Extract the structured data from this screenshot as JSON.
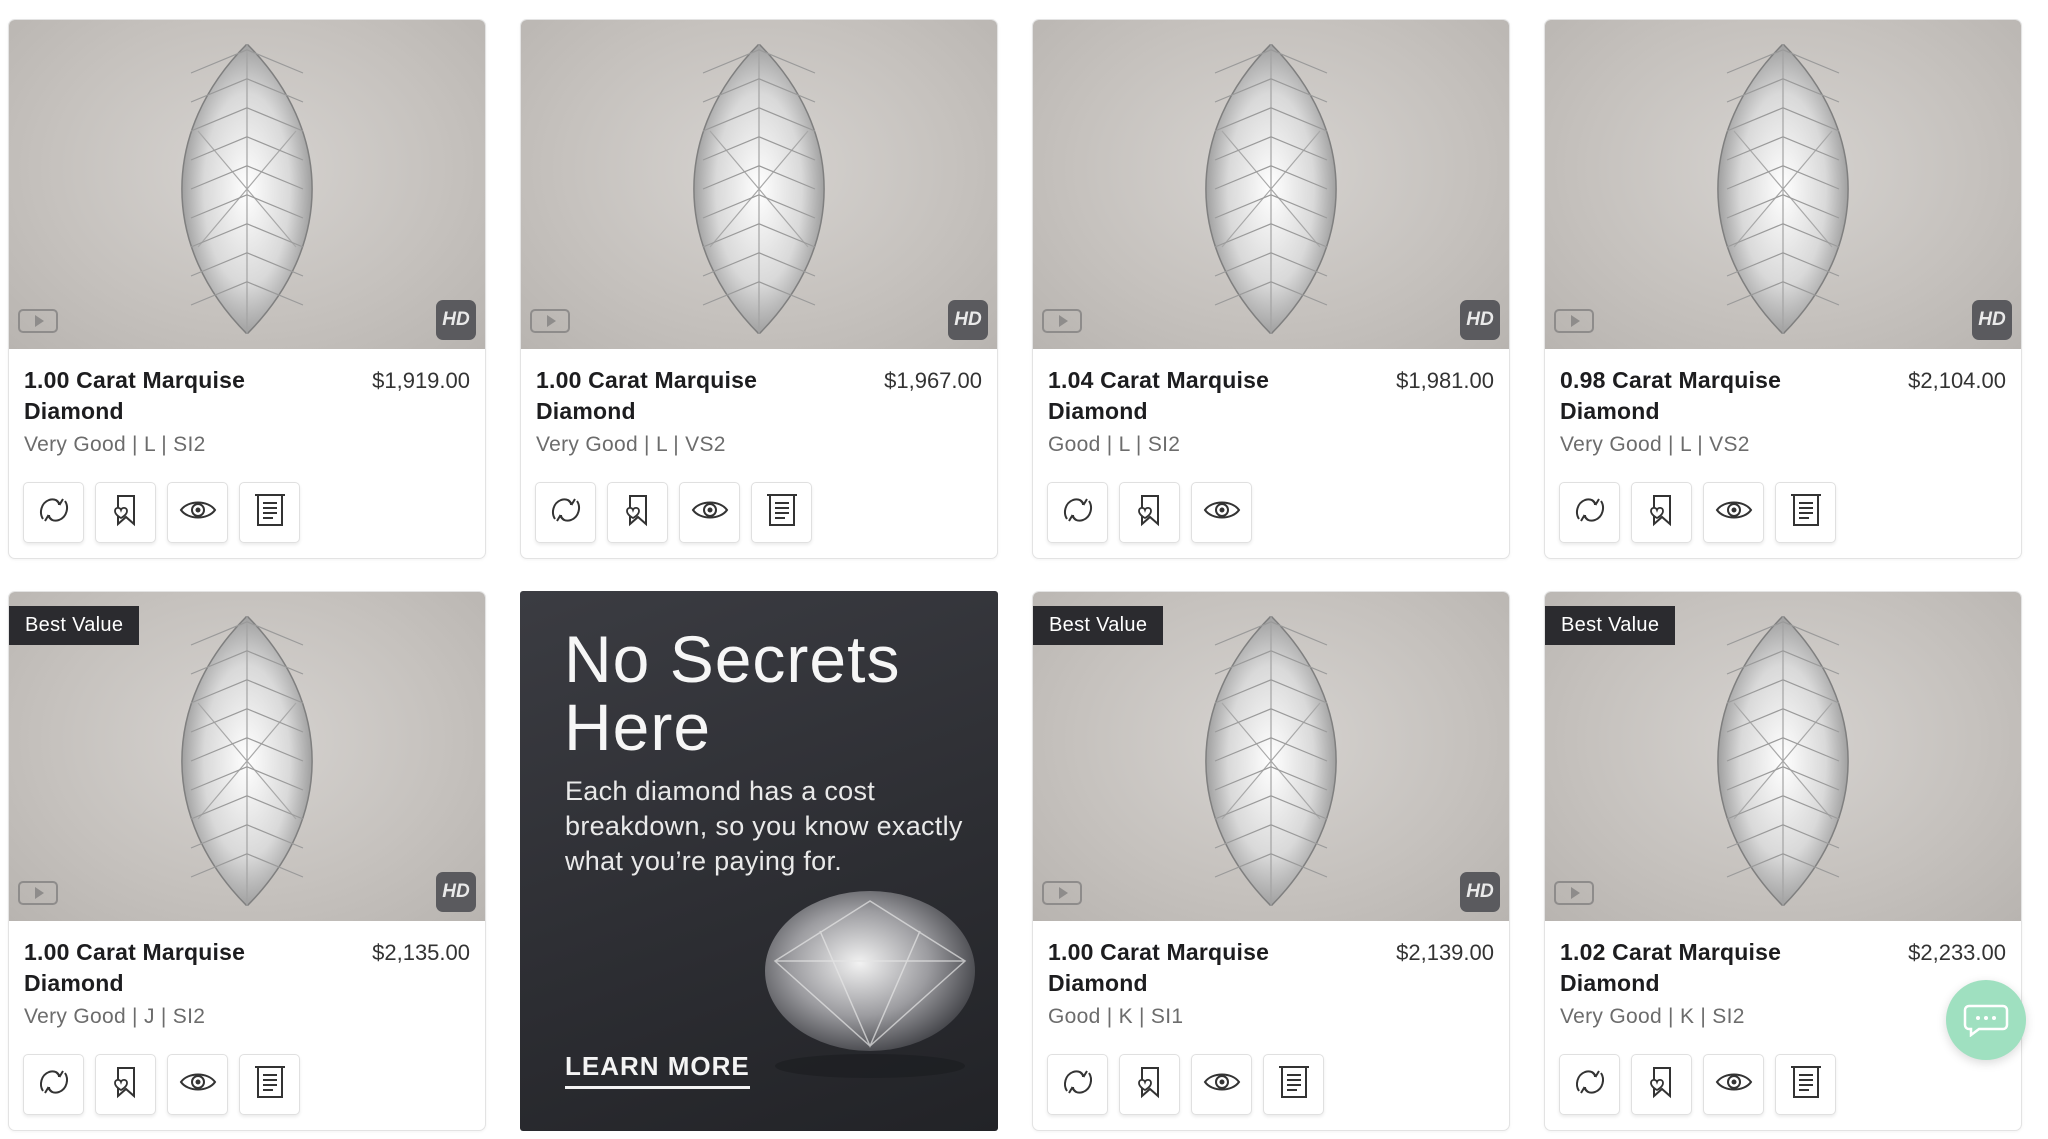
{
  "cards": [
    {
      "title": "1.00 Carat Marquise Diamond",
      "price": "$1,919.00",
      "specs": "Very Good | L | SI2",
      "badge": "",
      "hd": "HD",
      "actions": [
        "compare-icon",
        "wishlist-icon",
        "view-icon",
        "certificate-icon"
      ]
    },
    {
      "title": "1.00 Carat Marquise Diamond",
      "price": "$1,967.00",
      "specs": "Very Good | L | VS2",
      "badge": "",
      "hd": "HD",
      "actions": [
        "compare-icon",
        "wishlist-icon",
        "view-icon",
        "certificate-icon"
      ]
    },
    {
      "title": "1.04 Carat Marquise Diamond",
      "price": "$1,981.00",
      "specs": "Good | L | SI2",
      "badge": "",
      "hd": "HD",
      "actions": [
        "compare-icon",
        "wishlist-icon",
        "view-icon"
      ]
    },
    {
      "title": "0.98 Carat Marquise Diamond",
      "price": "$2,104.00",
      "specs": "Very Good | L | VS2",
      "badge": "",
      "hd": "HD",
      "actions": [
        "compare-icon",
        "wishlist-icon",
        "view-icon",
        "certificate-icon"
      ]
    },
    {
      "title": "1.00 Carat Marquise Diamond",
      "price": "$2,135.00",
      "specs": "Very Good | J | SI2",
      "badge": "Best Value",
      "hd": "HD",
      "actions": [
        "compare-icon",
        "wishlist-icon",
        "view-icon",
        "certificate-icon"
      ]
    },
    {
      "title": "1.00 Carat Marquise Diamond",
      "price": "$2,139.00",
      "specs": "Good | K | SI1",
      "badge": "Best Value",
      "hd": "HD",
      "actions": [
        "compare-icon",
        "wishlist-icon",
        "view-icon",
        "certificate-icon"
      ]
    },
    {
      "title": "1.02 Carat Marquise Diamond",
      "price": "$2,233.00",
      "specs": "Very Good | K | SI2",
      "badge": "Best Value",
      "hd": "",
      "actions": [
        "compare-icon",
        "wishlist-icon",
        "view-icon",
        "certificate-icon"
      ]
    }
  ],
  "promo": {
    "title": "No Secrets Here",
    "text": "Each diamond has a cost breakdown, so you know exactly what you’re paying for.",
    "link": "LEARN MORE"
  },
  "chat": {
    "icon": "chat-icon"
  },
  "colors": {
    "badge_bg": "#2b2b2f",
    "promo_bg": "#2d2e33",
    "chat_bg": "#9fe0c0"
  }
}
